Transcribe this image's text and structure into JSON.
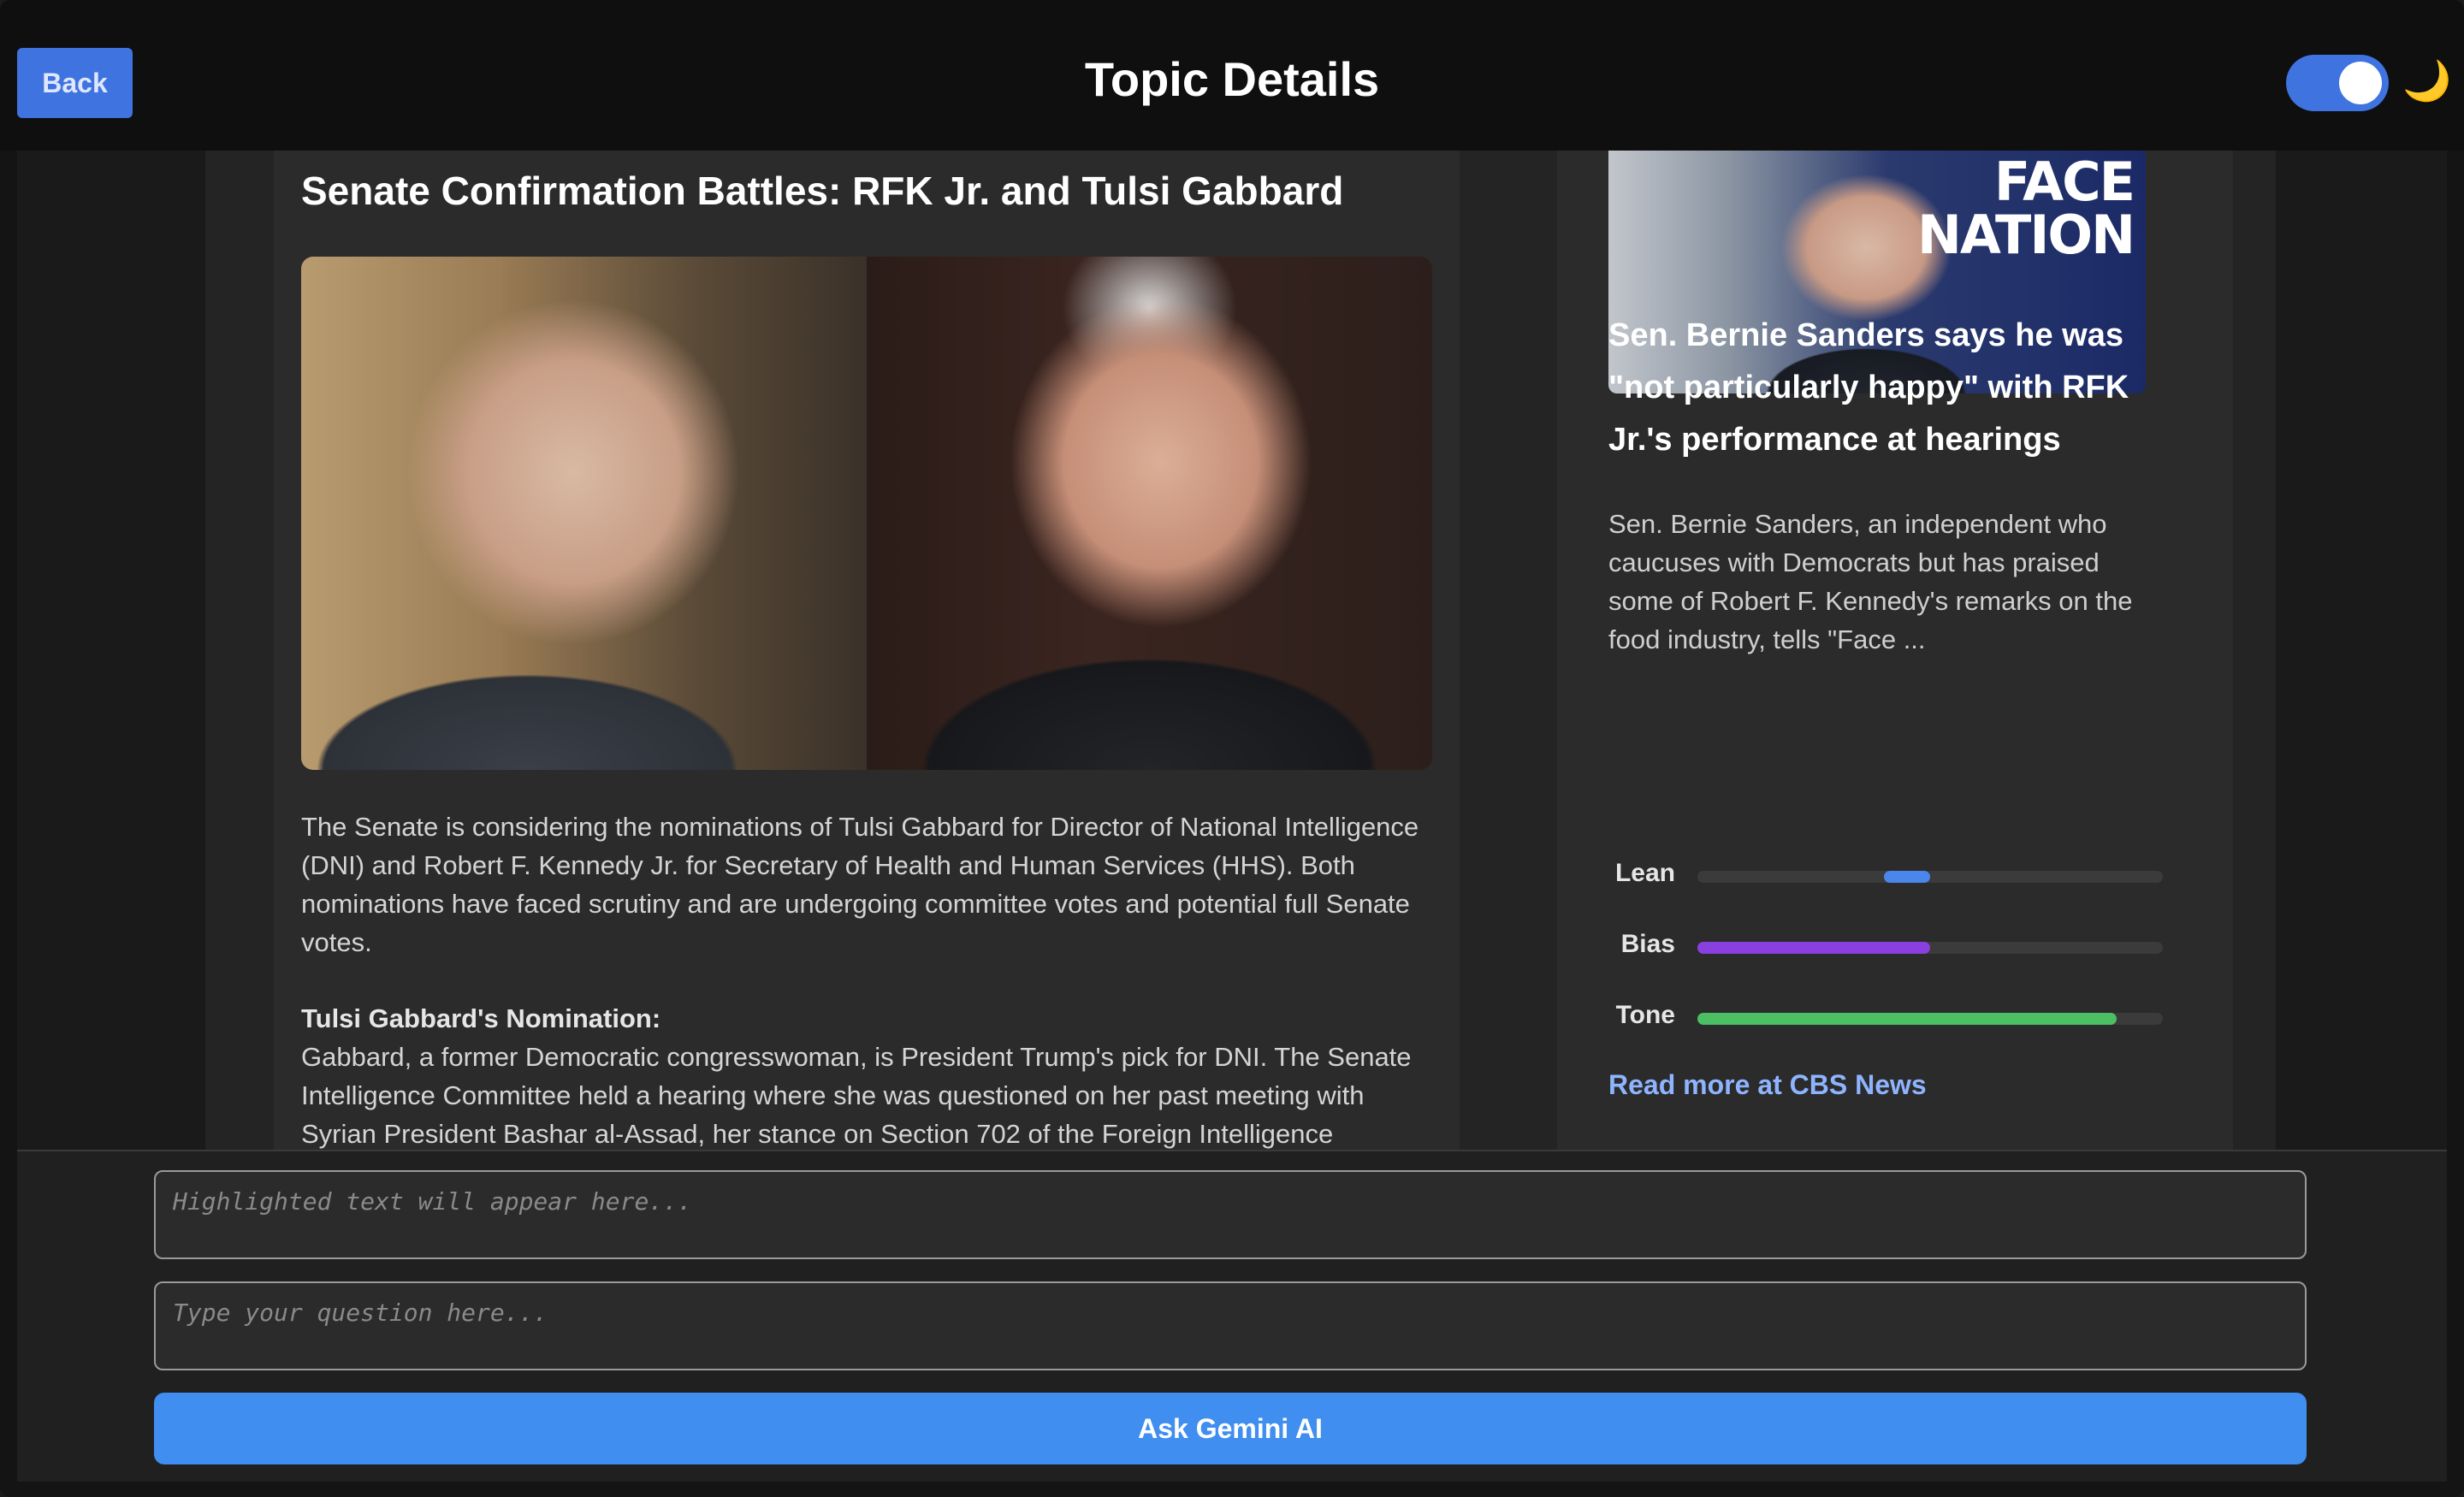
{
  "header": {
    "back_label": "Back",
    "title": "Topic Details",
    "dark_mode_on": true,
    "toggle_color": "#3f73e0",
    "moon_icon": "🌙"
  },
  "main_article": {
    "title": "Senate Confirmation Battles: RFK Jr. and Tulsi Gabbard",
    "intro": "The Senate is considering the nominations of Tulsi Gabbard for Director of National Intelligence (DNI) and Robert F. Kennedy Jr. for Secretary of Health and Human Services (HHS). Both nominations have faced scrutiny and are undergoing committee votes and potential full Senate votes.",
    "subhead": "Tulsi Gabbard's Nomination:",
    "section_text": "Gabbard, a former Democratic congresswoman, is President Trump's pick for DNI. The Senate Intelligence Committee held a hearing where she was questioned on her past meeting with Syrian President Bashar al-Assad, her stance on Section 702 of the Foreign Intelligence"
  },
  "side_article": {
    "image_label": "FACE THE NATION",
    "headline": "Sen. Bernie Sanders says he was \"not particularly happy\" with RFK Jr.'s performance at hearings",
    "summary": "Sen. Bernie Sanders, an independent who caucuses with Democrats but has praised some of Robert F. Kennedy's remarks on the food industry, tells \"Face ...",
    "meters": [
      {
        "label": "Lean",
        "start": 0.4,
        "value": 0.1,
        "color": "#4a86ec"
      },
      {
        "label": "Bias",
        "start": 0.0,
        "value": 0.5,
        "color": "#8a3fe0"
      },
      {
        "label": "Tone",
        "start": 0.0,
        "value": 0.9,
        "color": "#4cbe63"
      }
    ],
    "read_more": "Read more at CBS News"
  },
  "chat": {
    "highlight_placeholder": "Highlighted text will appear here...",
    "question_placeholder": "Type your question here...",
    "ask_label": "Ask Gemini AI"
  }
}
